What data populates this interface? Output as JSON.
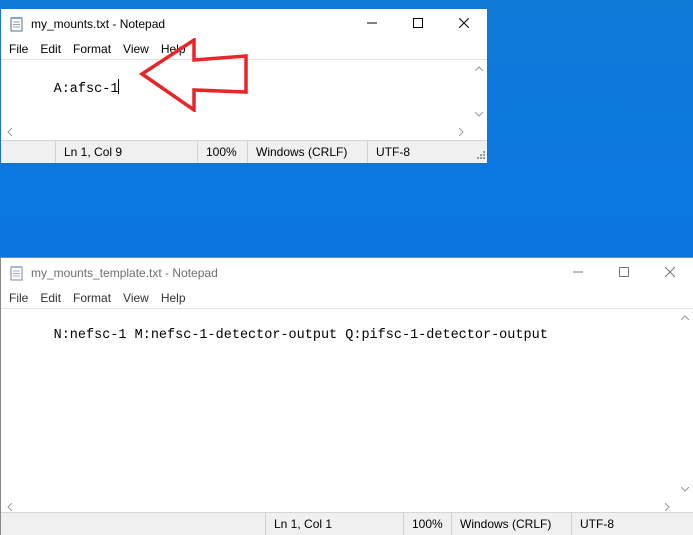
{
  "desktop": {
    "background_color": "#0a74d6"
  },
  "window1": {
    "title": "my_mounts.txt - Notepad",
    "menu": [
      "File",
      "Edit",
      "Format",
      "View",
      "Help"
    ],
    "content": "A:afsc-1",
    "status": {
      "position": "Ln 1, Col 9",
      "zoom": "100%",
      "line_endings": "Windows (CRLF)",
      "encoding": "UTF-8"
    }
  },
  "window2": {
    "title": "my_mounts_template.txt - Notepad",
    "menu": [
      "File",
      "Edit",
      "Format",
      "View",
      "Help"
    ],
    "content": "N:nefsc-1 M:nefsc-1-detector-output Q:pifsc-1-detector-output",
    "status": {
      "position": "Ln 1, Col 1",
      "zoom": "100%",
      "line_endings": "Windows (CRLF)",
      "encoding": "UTF-8"
    }
  },
  "annotation": {
    "arrow_color": "#e8262a",
    "arrow_icon": "left-arrow-annotation"
  },
  "icons": {
    "app": "notepad-icon",
    "minimize": "minimize-icon",
    "maximize": "maximize-icon",
    "close": "close-icon"
  }
}
